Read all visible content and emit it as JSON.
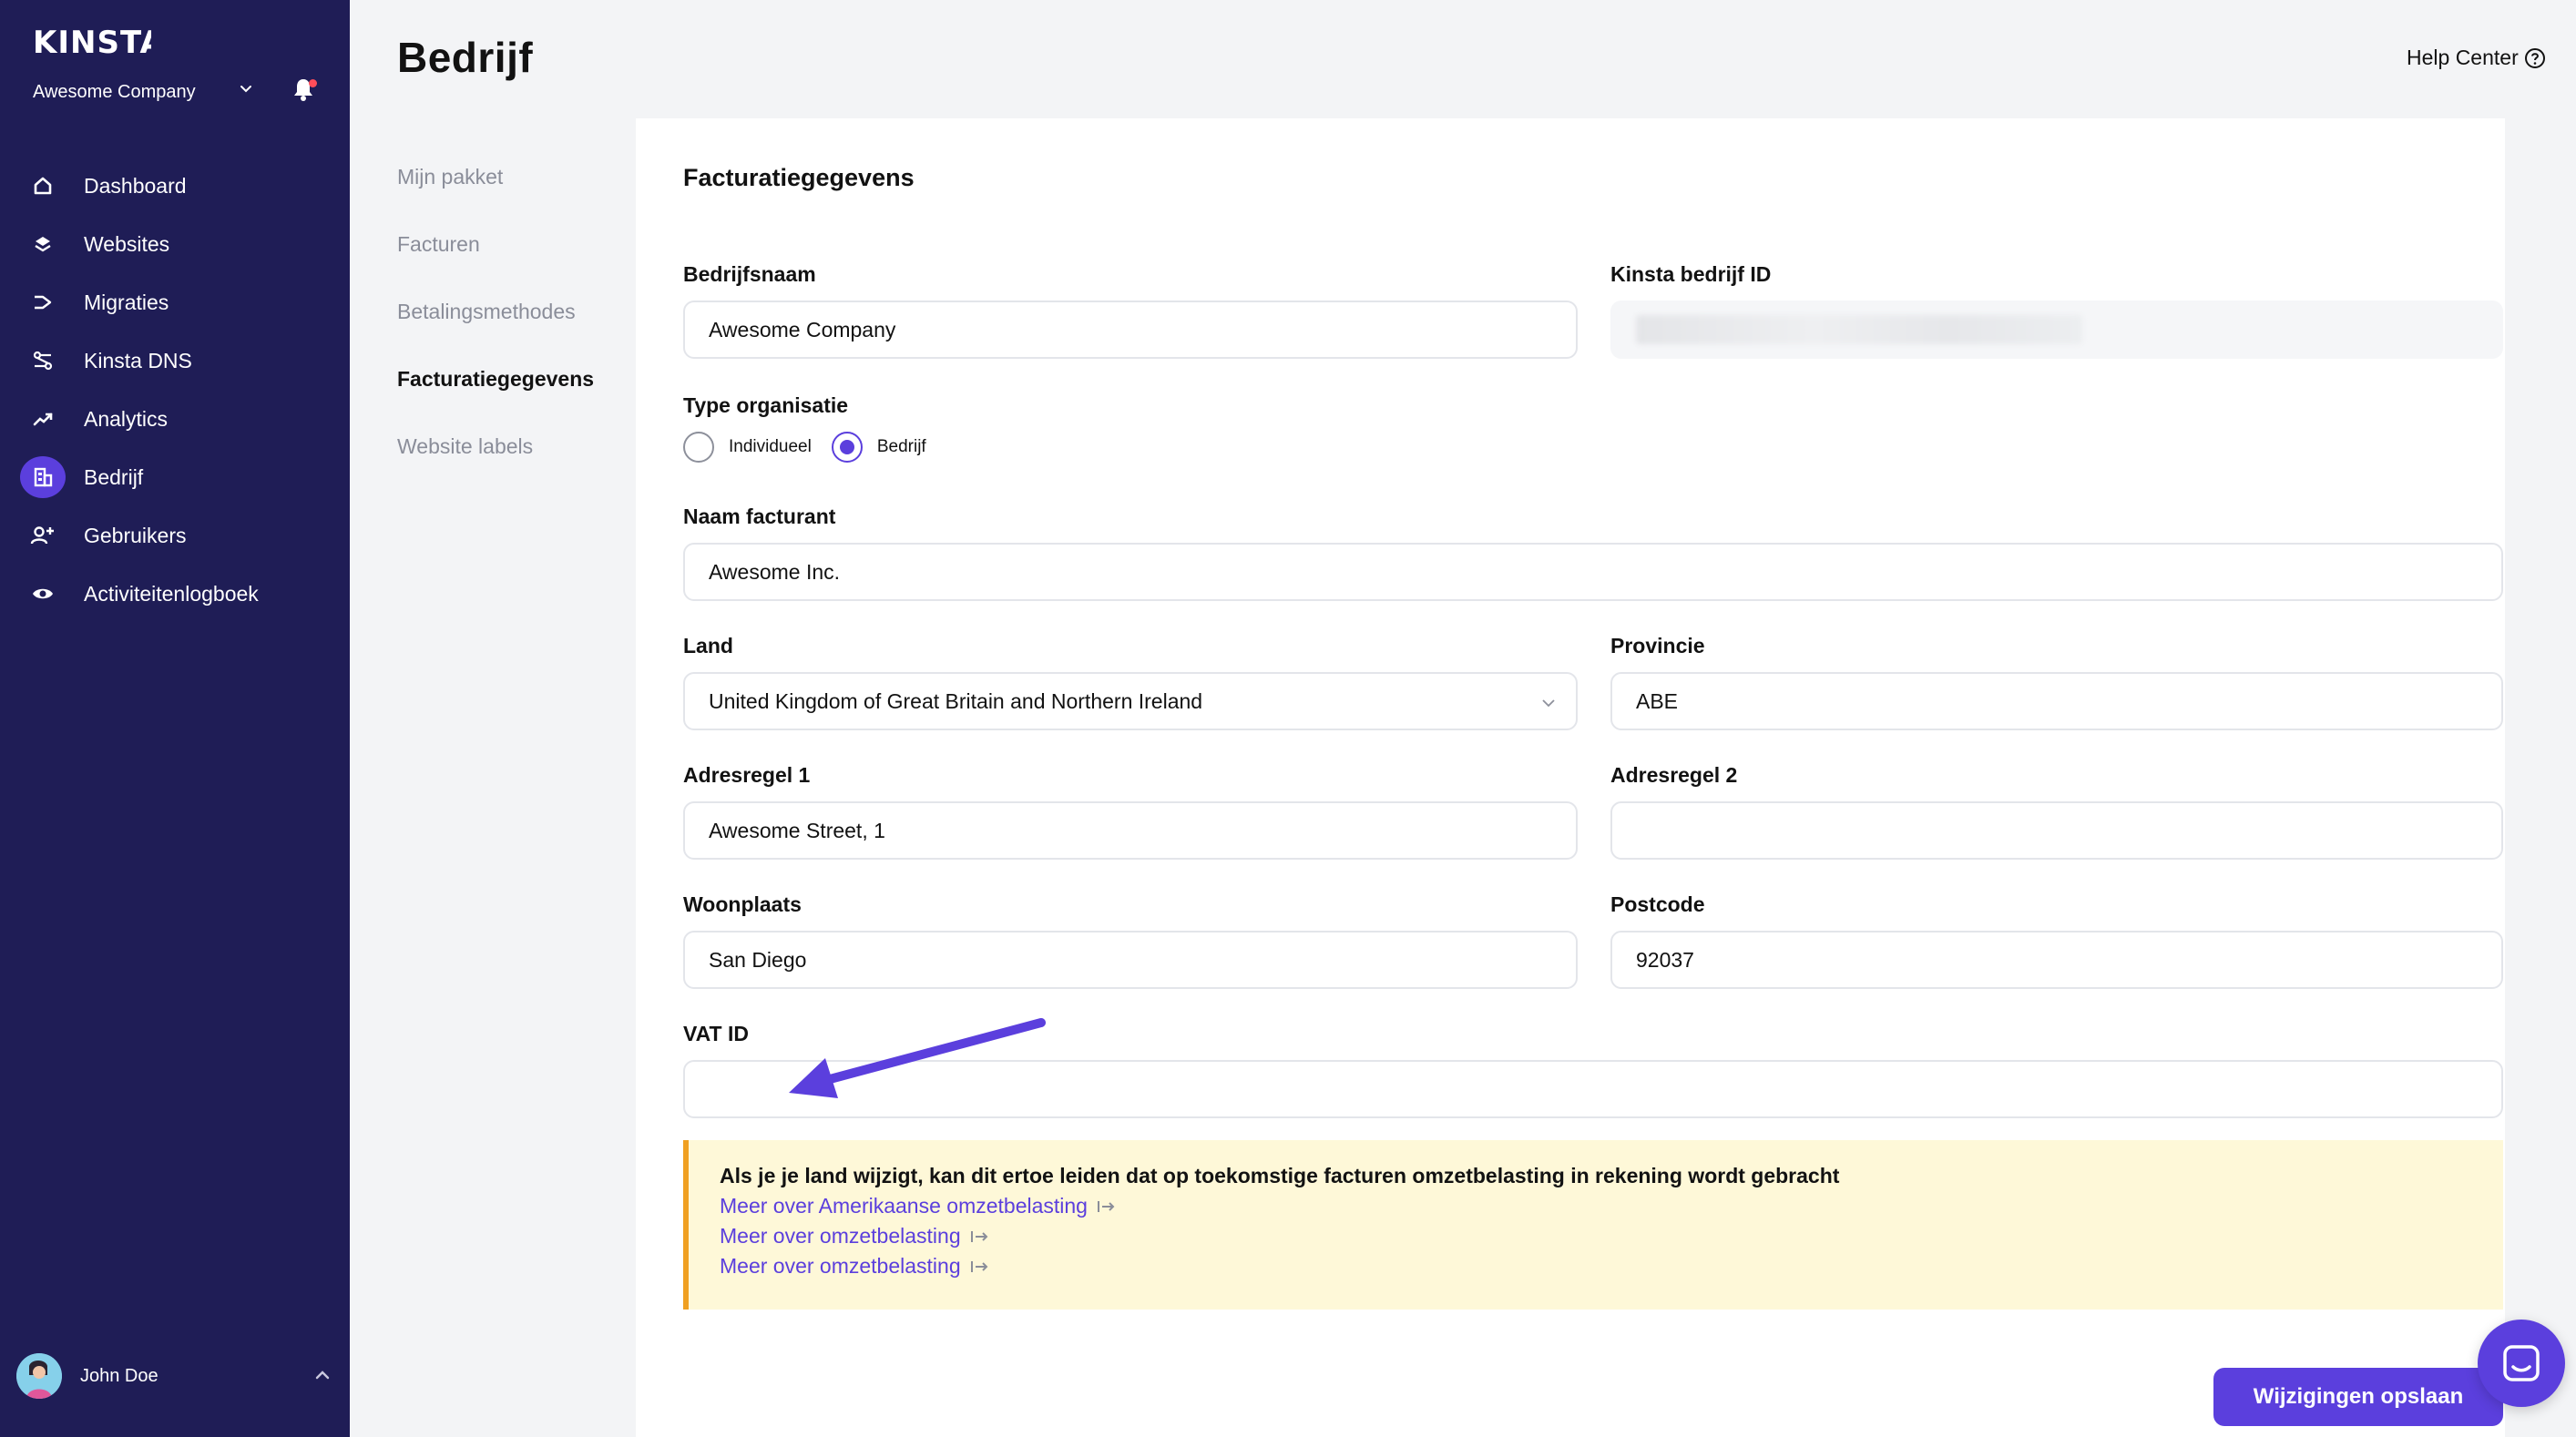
{
  "sidebar": {
    "logo": "KINSTA",
    "company": "Awesome Company",
    "items": [
      {
        "label": "Dashboard",
        "icon": "home-icon"
      },
      {
        "label": "Websites",
        "icon": "layers-icon"
      },
      {
        "label": "Migraties",
        "icon": "migrate-icon"
      },
      {
        "label": "Kinsta DNS",
        "icon": "dns-icon"
      },
      {
        "label": "Analytics",
        "icon": "trend-icon"
      },
      {
        "label": "Bedrijf",
        "icon": "building-icon",
        "active": true
      },
      {
        "label": "Gebruikers",
        "icon": "add-user-icon"
      },
      {
        "label": "Activiteitenlogboek",
        "icon": "eye-icon"
      }
    ],
    "user_name": "John Doe"
  },
  "header": {
    "title": "Bedrijf",
    "help_center": "Help Center"
  },
  "subnav": {
    "items": [
      {
        "label": "Mijn pakket"
      },
      {
        "label": "Facturen"
      },
      {
        "label": "Betalingsmethodes"
      },
      {
        "label": "Facturatiegegevens",
        "active": true
      },
      {
        "label": "Website labels"
      }
    ]
  },
  "form": {
    "title": "Facturatiegegevens",
    "company_name": {
      "label": "Bedrijfsnaam",
      "value": "Awesome Company"
    },
    "kinsta_id": {
      "label": "Kinsta bedrijf ID"
    },
    "org_type": {
      "label": "Type organisatie",
      "options": [
        {
          "label": "Individueel",
          "checked": false
        },
        {
          "label": "Bedrijf",
          "checked": true
        }
      ]
    },
    "invoice_name": {
      "label": "Naam facturant",
      "value": "Awesome Inc."
    },
    "country": {
      "label": "Land",
      "value": "United Kingdom of Great Britain and Northern Ireland"
    },
    "province": {
      "label": "Provincie",
      "value": "ABE"
    },
    "address1": {
      "label": "Adresregel 1",
      "value": "Awesome Street, 1"
    },
    "address2": {
      "label": "Adresregel 2",
      "value": ""
    },
    "city": {
      "label": "Woonplaats",
      "value": "San Diego"
    },
    "postcode": {
      "label": "Postcode",
      "value": "92037"
    },
    "vat": {
      "label": "VAT ID",
      "value": ""
    }
  },
  "notice": {
    "message": "Als je je land wijzigt, kan dit ertoe leiden dat op toekomstige facturen omzetbelasting in rekening wordt gebracht",
    "links": [
      "Meer over Amerikaanse omzetbelasting",
      "Meer over omzetbelasting",
      "Meer over omzetbelasting"
    ]
  },
  "save_button": "Wijzigingen opslaan",
  "colors": {
    "sidebar_bg": "#1f1d56",
    "accent": "#5b3fdd",
    "notice_bg": "#fef8d8",
    "notice_border": "#f0a021",
    "notification_dot": "#ff4d5a"
  }
}
